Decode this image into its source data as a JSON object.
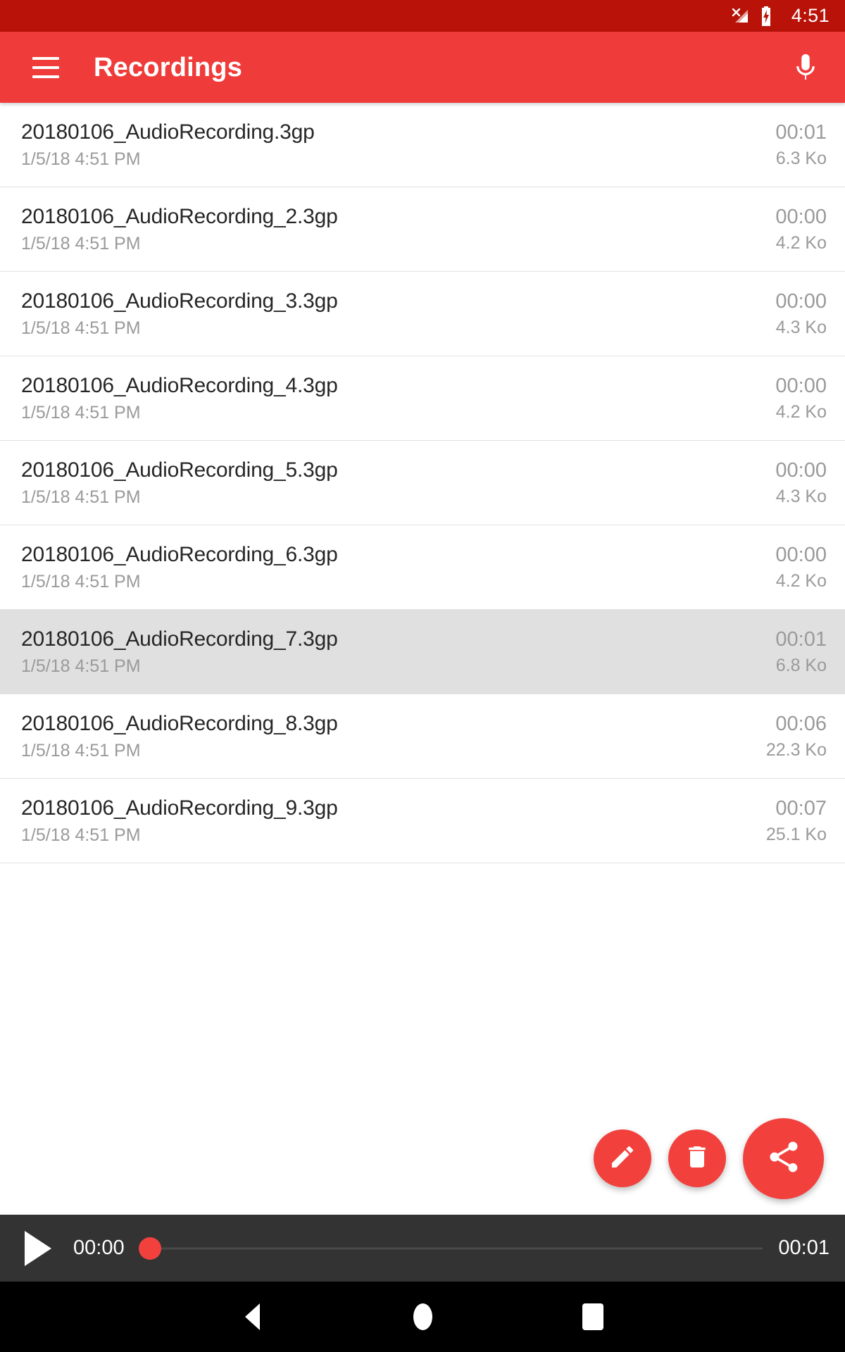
{
  "status_bar": {
    "time": "4:51",
    "signal_icon": "cellular-no-sim-icon",
    "battery_icon": "battery-charging-icon",
    "background": "#B81209"
  },
  "app_bar": {
    "title": "Recordings",
    "menu_icon": "hamburger-menu-icon",
    "mic_icon": "microphone-icon",
    "background": "#EF3B39",
    "text_color": "#FFFFFF"
  },
  "list": {
    "columns": [
      "name",
      "date",
      "duration",
      "size"
    ],
    "selected_index": 6,
    "selected_background": "#E0E0E0",
    "items": [
      {
        "name": "20180106_AudioRecording.3gp",
        "date": "1/5/18 4:51 PM",
        "duration": "00:01",
        "size": "6.3 Ko"
      },
      {
        "name": "20180106_AudioRecording_2.3gp",
        "date": "1/5/18 4:51 PM",
        "duration": "00:00",
        "size": "4.2 Ko"
      },
      {
        "name": "20180106_AudioRecording_3.3gp",
        "date": "1/5/18 4:51 PM",
        "duration": "00:00",
        "size": "4.3 Ko"
      },
      {
        "name": "20180106_AudioRecording_4.3gp",
        "date": "1/5/18 4:51 PM",
        "duration": "00:00",
        "size": "4.2 Ko"
      },
      {
        "name": "20180106_AudioRecording_5.3gp",
        "date": "1/5/18 4:51 PM",
        "duration": "00:00",
        "size": "4.3 Ko"
      },
      {
        "name": "20180106_AudioRecording_6.3gp",
        "date": "1/5/18 4:51 PM",
        "duration": "00:00",
        "size": "4.2 Ko"
      },
      {
        "name": "20180106_AudioRecording_7.3gp",
        "date": "1/5/18 4:51 PM",
        "duration": "00:01",
        "size": "6.8 Ko"
      },
      {
        "name": "20180106_AudioRecording_8.3gp",
        "date": "1/5/18 4:51 PM",
        "duration": "00:06",
        "size": "22.3 Ko"
      },
      {
        "name": "20180106_AudioRecording_9.3gp",
        "date": "1/5/18 4:51 PM",
        "duration": "00:07",
        "size": "25.1 Ko"
      }
    ]
  },
  "fabs": {
    "accent_color": "#F2413D",
    "buttons": [
      {
        "name": "edit-fab",
        "icon": "pencil-icon",
        "size": "small"
      },
      {
        "name": "delete-fab",
        "icon": "trash-icon",
        "size": "small"
      },
      {
        "name": "share-fab",
        "icon": "share-icon",
        "size": "large"
      }
    ]
  },
  "player": {
    "play_icon": "play-icon",
    "current_time": "00:00",
    "total_time": "00:01",
    "progress_percent": 0,
    "background": "#333333",
    "thumb_color": "#F2413D"
  },
  "nav_bar": {
    "back_icon": "back-triangle-icon",
    "home_icon": "home-circle-icon",
    "recents_icon": "recents-square-icon",
    "background": "#000000"
  }
}
